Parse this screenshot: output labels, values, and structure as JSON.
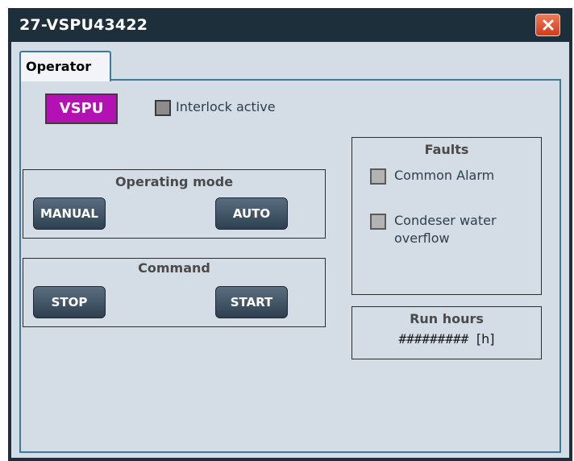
{
  "window": {
    "title": "27-VSPU43422",
    "close_icon": "close-icon"
  },
  "tabs": [
    {
      "label": "Operator",
      "active": true
    }
  ],
  "operator": {
    "unit_label": "VSPU",
    "unit_color": "#b411b4",
    "interlock_label": "Interlock active",
    "operating_mode": {
      "title": "Operating mode",
      "buttons": [
        "MANUAL",
        "AUTO"
      ]
    },
    "command": {
      "title": "Command",
      "buttons": [
        "STOP",
        "START"
      ]
    },
    "faults": {
      "title": "Faults",
      "items": [
        {
          "label": "Common Alarm"
        },
        {
          "label": "Condeser water overflow"
        }
      ]
    },
    "run_hours": {
      "title": "Run hours",
      "value": "#########",
      "unit": "[h]"
    }
  }
}
